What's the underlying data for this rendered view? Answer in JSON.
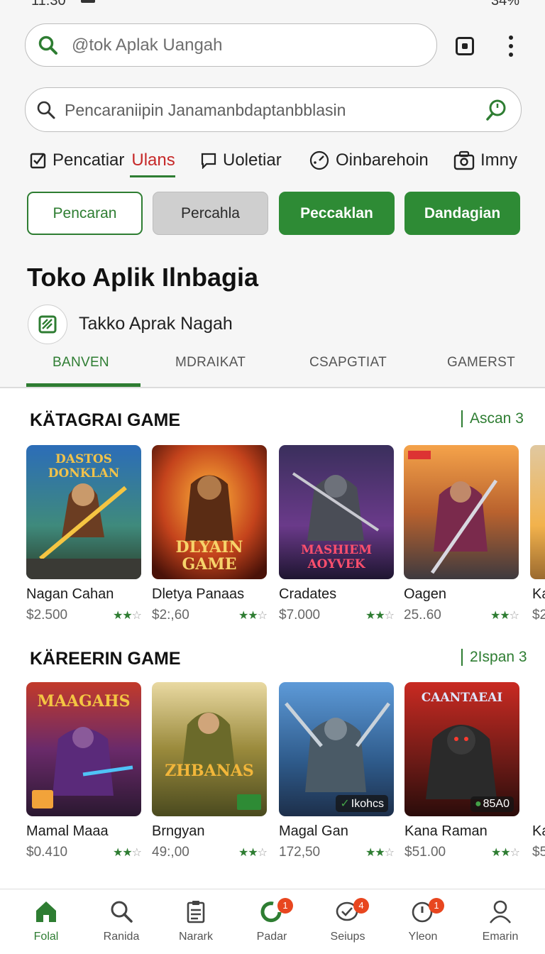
{
  "status_bar": {
    "time": "11:30",
    "right": "34%"
  },
  "top_search": {
    "placeholder": "@tok Aplak Uangah"
  },
  "search": {
    "placeholder": "Pencaraniipin Janamanbdaptanbblasin"
  },
  "quick_tabs": [
    {
      "label": "Pencatiar",
      "accent": "Ulans",
      "icon": "checkbox-icon"
    },
    {
      "label": "Uoletiar",
      "icon": "chat-icon"
    },
    {
      "label": "Oinbarehoin",
      "icon": "gauge-icon"
    },
    {
      "label": "Imny",
      "icon": "camera-icon"
    }
  ],
  "chips": [
    "Pencaran",
    "Percahla",
    "Peccaklan",
    "Dandagian"
  ],
  "store": {
    "title": "Toko Aplik Ilnbagia",
    "name": "Takko Aprak Nagah"
  },
  "category_tabs": [
    "BANVEN",
    "MDRAIKAT",
    "CSAPGTIAT",
    "GAMERST"
  ],
  "sections": [
    {
      "title": "KÄTAGRAI GAME",
      "more": "Ascan 3",
      "items": [
        {
          "name": "Nagan Cahan",
          "price": "$2.500",
          "rating": 2,
          "art_text": "DASTOS DONKLAN",
          "palette": "blue"
        },
        {
          "name": "Dletya Panaas",
          "price": "$2:,60",
          "rating": 2,
          "art_text": "DLYAIN GAME",
          "palette": "fire"
        },
        {
          "name": "Cradates",
          "price": "$7.000",
          "rating": 2,
          "art_text": "MASHIEM AOYVEK",
          "palette": "purple"
        },
        {
          "name": "Oagen",
          "price": "25..60",
          "rating": 2,
          "art_text": "",
          "palette": "sunset"
        }
      ],
      "peek": {
        "name": "Ka",
        "price": "$2"
      }
    },
    {
      "title": "KÄREERIN GAME",
      "more": "2Ispan 3",
      "items": [
        {
          "name": "Mamal Maaa",
          "price": "$0.410",
          "rating": 2,
          "art_text": "MAAGAHS",
          "palette": "magenta",
          "badge": ""
        },
        {
          "name": "Brngyan",
          "price": "49:,00",
          "rating": 2,
          "art_text": "ZHBANAS",
          "palette": "olive",
          "badge": ""
        },
        {
          "name": "Magal Gan",
          "price": "172,50",
          "rating": 2,
          "art_text": "",
          "palette": "steel",
          "badge": "Ikohcs"
        },
        {
          "name": "Kana Raman",
          "price": "$51.00",
          "rating": 2,
          "art_text": "CAANTAEAI",
          "palette": "red",
          "badge": "85A0"
        }
      ],
      "peek": {
        "name": "Ka",
        "price": "$5"
      }
    }
  ],
  "bottom_nav": [
    {
      "label": "Folal",
      "icon": "home-icon",
      "active": true,
      "badge": ""
    },
    {
      "label": "Ranida",
      "icon": "search-icon",
      "active": false,
      "badge": ""
    },
    {
      "label": "Narark",
      "icon": "clipboard-icon",
      "active": false,
      "badge": ""
    },
    {
      "label": "Padar",
      "icon": "refresh-icon",
      "active": false,
      "badge": "1"
    },
    {
      "label": "Seiups",
      "icon": "message-icon",
      "active": false,
      "badge": "4"
    },
    {
      "label": "Yleon",
      "icon": "clock-icon",
      "active": false,
      "badge": "1"
    },
    {
      "label": "Emarin",
      "icon": "person-icon",
      "active": false,
      "badge": ""
    }
  ],
  "colors": {
    "accent": "#2e7d32",
    "badge": "#e8461f",
    "alert": "#c62828"
  }
}
